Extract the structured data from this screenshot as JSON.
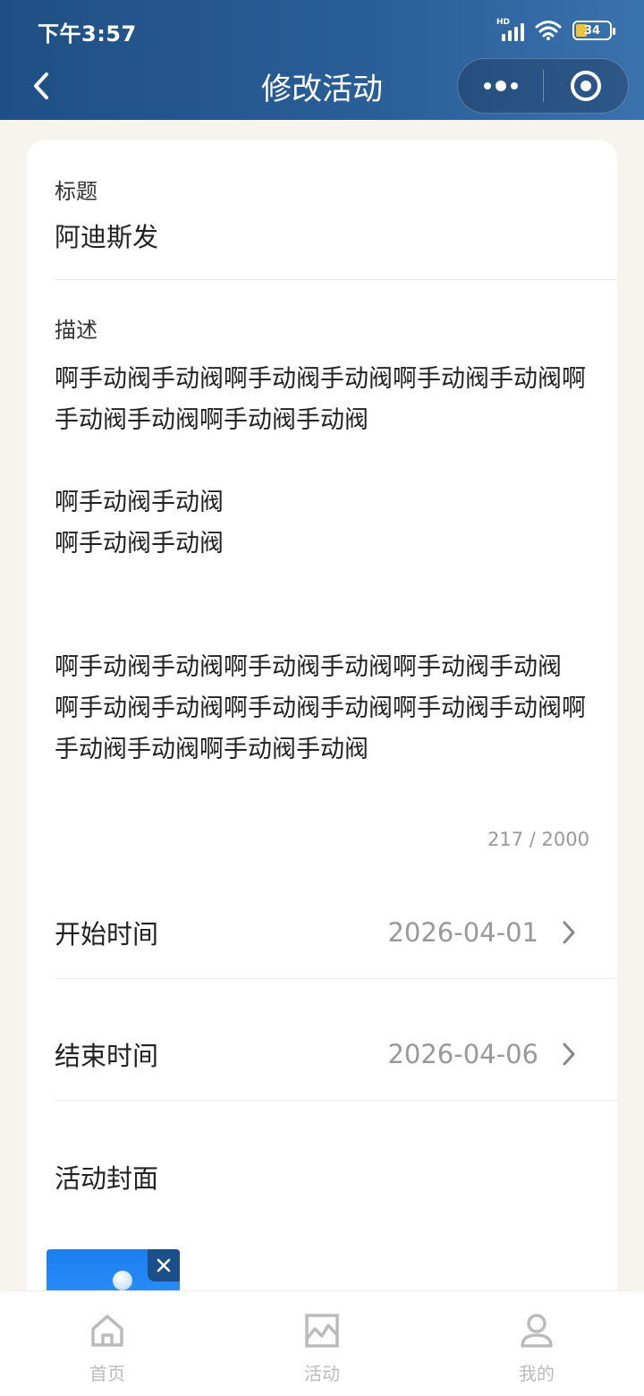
{
  "status_bar": {
    "time": "下午3:57",
    "signal_badge": "HD",
    "battery": "34"
  },
  "nav": {
    "title": "修改活动"
  },
  "form": {
    "title_label": "标题",
    "title_value": "阿迪斯发",
    "desc_label": "描述",
    "desc_paragraphs": [
      "啊手动阀手动阀啊手动阀手动阀啊手动阀手动阀啊手动阀手动阀啊手动阀手动阀",
      "",
      "啊手动阀手动阀",
      "啊手动阀手动阀",
      "",
      "",
      "啊手动阀手动阀啊手动阀手动阀啊手动阀手动阀",
      "啊手动阀手动阀啊手动阀手动阀啊手动阀手动阀啊手动阀手动阀啊手动阀手动阀"
    ],
    "desc_count": "217 / 2000",
    "start_label": "开始时间",
    "start_value": "2026-04-01",
    "end_label": "结束时间",
    "end_value": "2026-04-06",
    "cover_label": "活动封面"
  },
  "tabbar": {
    "items": [
      {
        "label": "首页",
        "icon": "home-icon"
      },
      {
        "label": "活动",
        "icon": "activity-chart-icon"
      },
      {
        "label": "我的",
        "icon": "user-icon"
      }
    ]
  },
  "colors": {
    "header": "#2b5f98",
    "background": "#f7f4ef",
    "muted": "#999999",
    "thumb_blue": "#1a7ef0"
  }
}
